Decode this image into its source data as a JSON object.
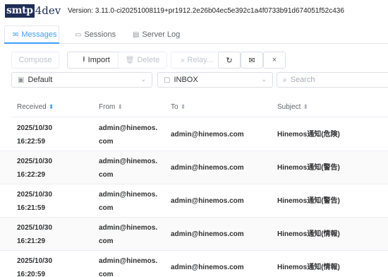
{
  "app": {
    "logo_box": "smtp",
    "logo_tail": "4dev",
    "version": "Version: 3.11.0-ci20251008119+pr1912.2e26b04ec5e392c1a4f0733b91d674051f52c436"
  },
  "tabs": [
    {
      "label": "Messages",
      "icon": "envelope-icon",
      "active": true
    },
    {
      "label": "Sessions",
      "icon": "monitor-icon",
      "active": false
    },
    {
      "label": "Server Log",
      "icon": "document-icon",
      "active": false
    }
  ],
  "toolbar": {
    "compose": "Compose",
    "import": "Import",
    "delete": "Delete",
    "relay": "Relay..."
  },
  "filters": {
    "mailbox": "Default",
    "folder": "INBOX",
    "search_placeholder": "Search"
  },
  "table": {
    "columns": [
      "Received",
      "From",
      "To",
      "Subject"
    ],
    "rows": [
      {
        "date": "2025/10/30",
        "time": "16:22:59",
        "from_a": "admin@hinemos.",
        "from_b": "com",
        "to": "admin@hinemos.com",
        "subject": "Hinemos通知(危険)"
      },
      {
        "date": "2025/10/30",
        "time": "16:22:29",
        "from_a": "admin@hinemos.",
        "from_b": "com",
        "to": "admin@hinemos.com",
        "subject": "Hinemos通知(警告)"
      },
      {
        "date": "2025/10/30",
        "time": "16:21:59",
        "from_a": "admin@hinemos.",
        "from_b": "com",
        "to": "admin@hinemos.com",
        "subject": "Hinemos通知(警告)"
      },
      {
        "date": "2025/10/30",
        "time": "16:21:29",
        "from_a": "admin@hinemos.",
        "from_b": "com",
        "to": "admin@hinemos.com",
        "subject": "Hinemos通知(情報)"
      },
      {
        "date": "2025/10/30",
        "time": "16:20:59",
        "from_a": "admin@hinemos.",
        "from_b": "com",
        "to": "admin@hinemos.com",
        "subject": "Hinemos通知(情報)"
      }
    ]
  },
  "colors": {
    "accent": "#409eff",
    "logo": "#1f2e57"
  }
}
